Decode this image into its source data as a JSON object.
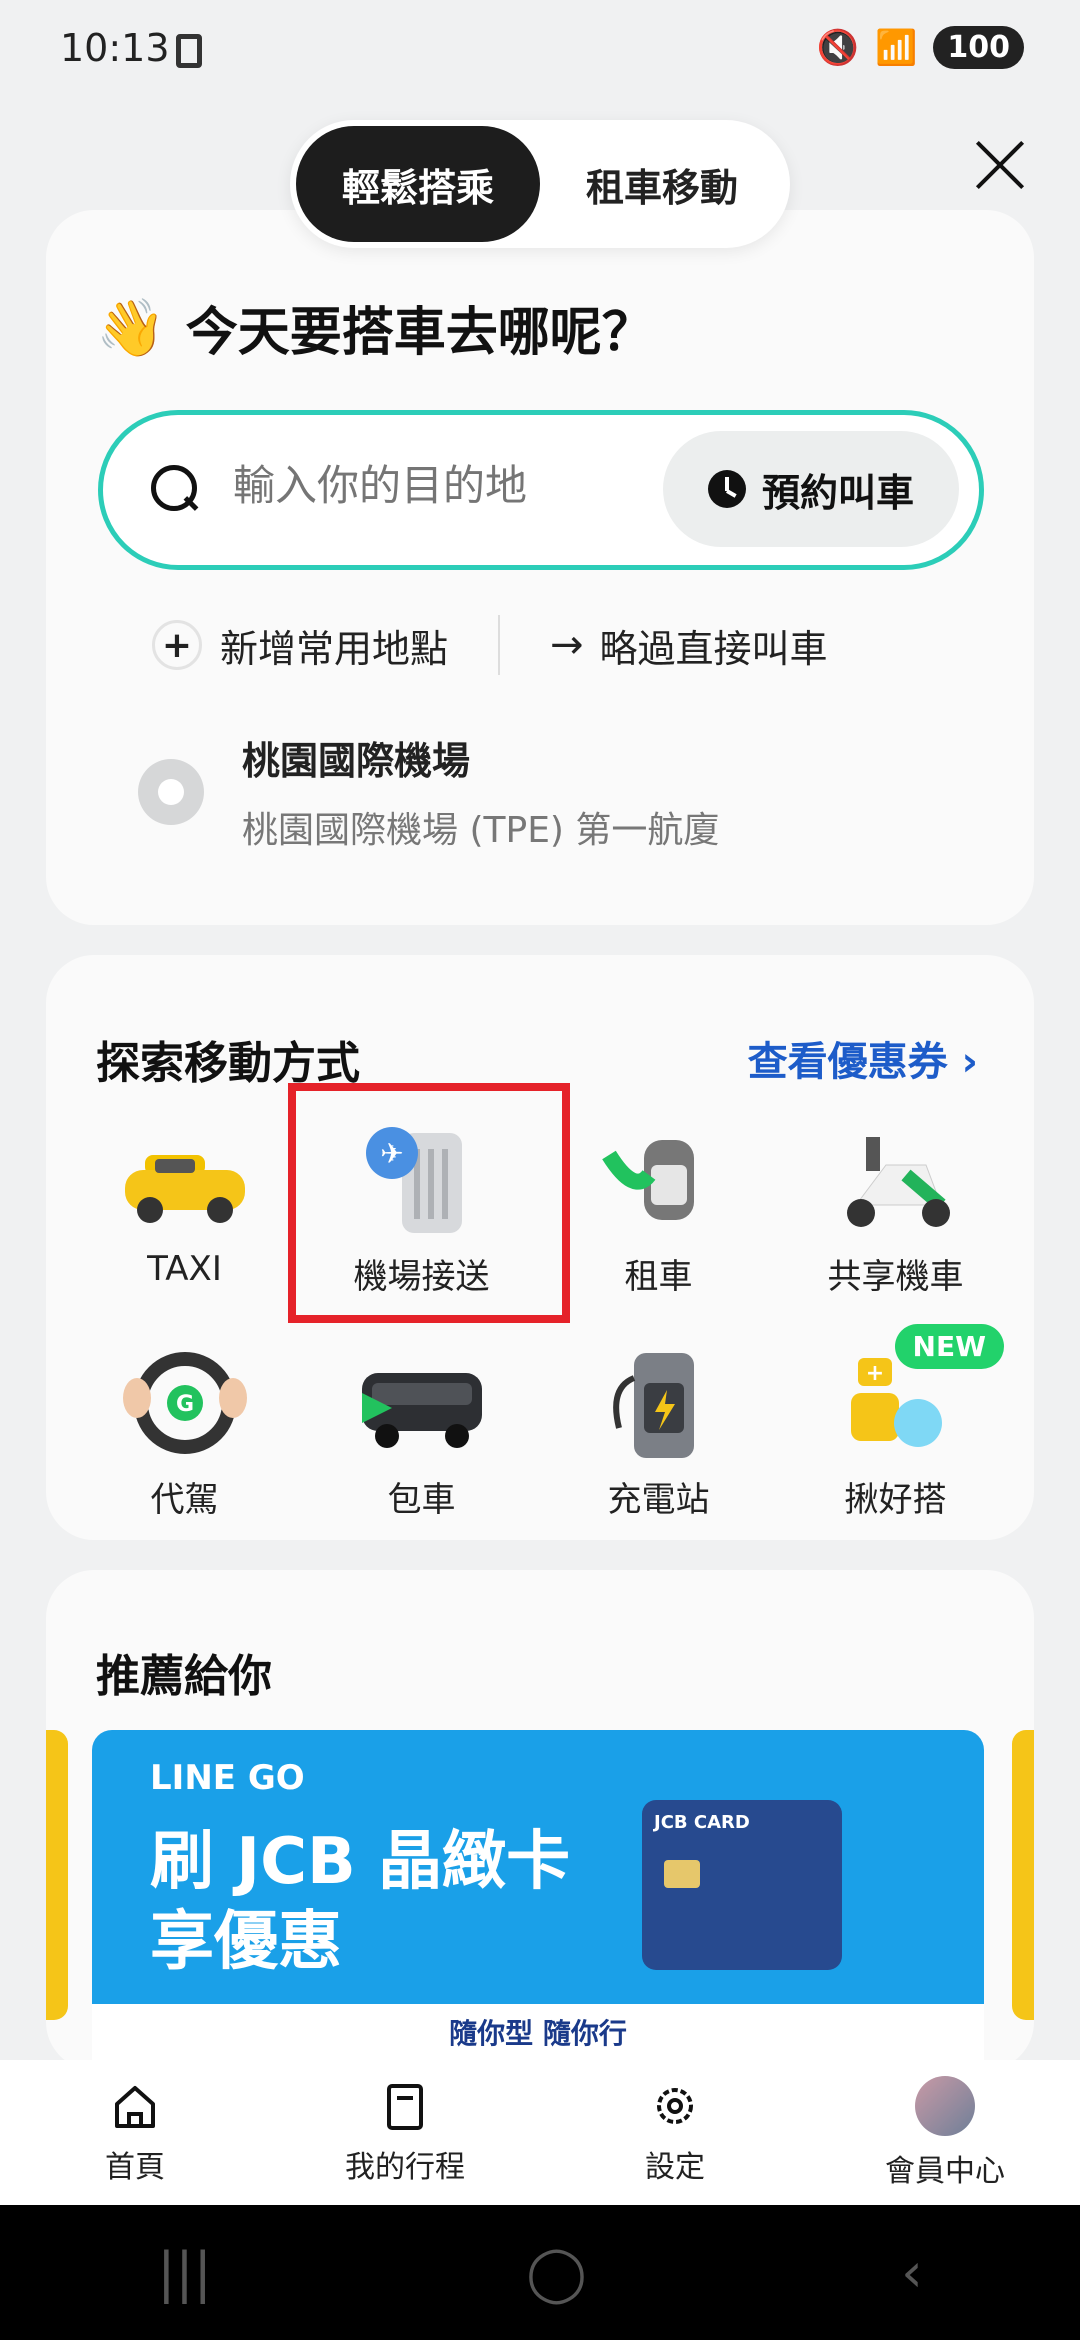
{
  "status_bar": {
    "time": "10:13",
    "battery": "100"
  },
  "mode_toggle": {
    "ride": "輕鬆搭乘",
    "rent": "租車移動"
  },
  "greeting": {
    "emoji": "👋",
    "text": "今天要搭車去哪呢？"
  },
  "search": {
    "placeholder": "輸入你的目的地",
    "reserve_label": "預約叫車"
  },
  "quick_links": {
    "add_place": "新增常用地點",
    "skip": "略過直接叫車"
  },
  "recent_place": {
    "title": "桃園國際機場",
    "subtitle": "桃園國際機場 (TPE) 第一航廈"
  },
  "explore": {
    "title": "探索移動方式",
    "coupon_link": "查看優惠券",
    "services": [
      {
        "label": "TAXI",
        "icon": "taxi-icon"
      },
      {
        "label": "機場接送",
        "icon": "airport-luggage-icon"
      },
      {
        "label": "租車",
        "icon": "car-key-icon"
      },
      {
        "label": "共享機車",
        "icon": "scooter-icon"
      },
      {
        "label": "代駕",
        "icon": "steering-wheel-icon"
      },
      {
        "label": "包車",
        "icon": "van-icon"
      },
      {
        "label": "充電站",
        "icon": "charger-icon"
      },
      {
        "label": "揪好搭",
        "icon": "group-ride-icon",
        "badge": "NEW"
      }
    ]
  },
  "recommended": {
    "title": "推薦給你",
    "banner": {
      "brand": "LINE GO",
      "headline1": "刷 JCB 晶緻卡",
      "headline2": "享優惠",
      "card_text": "JCB CARD",
      "footer": "隨你型 隨你行"
    }
  },
  "bottom_nav": [
    {
      "label": "首頁",
      "icon": "home-icon"
    },
    {
      "label": "我的行程",
      "icon": "trips-icon"
    },
    {
      "label": "設定",
      "icon": "gear-icon"
    },
    {
      "label": "會員中心",
      "icon": "avatar"
    }
  ],
  "colors": {
    "accent_border": "#2ccdb8",
    "link_blue": "#1d5cc9",
    "highlight_red": "#e52229",
    "new_green": "#22d26b",
    "banner_blue": "#1aa0e8"
  }
}
